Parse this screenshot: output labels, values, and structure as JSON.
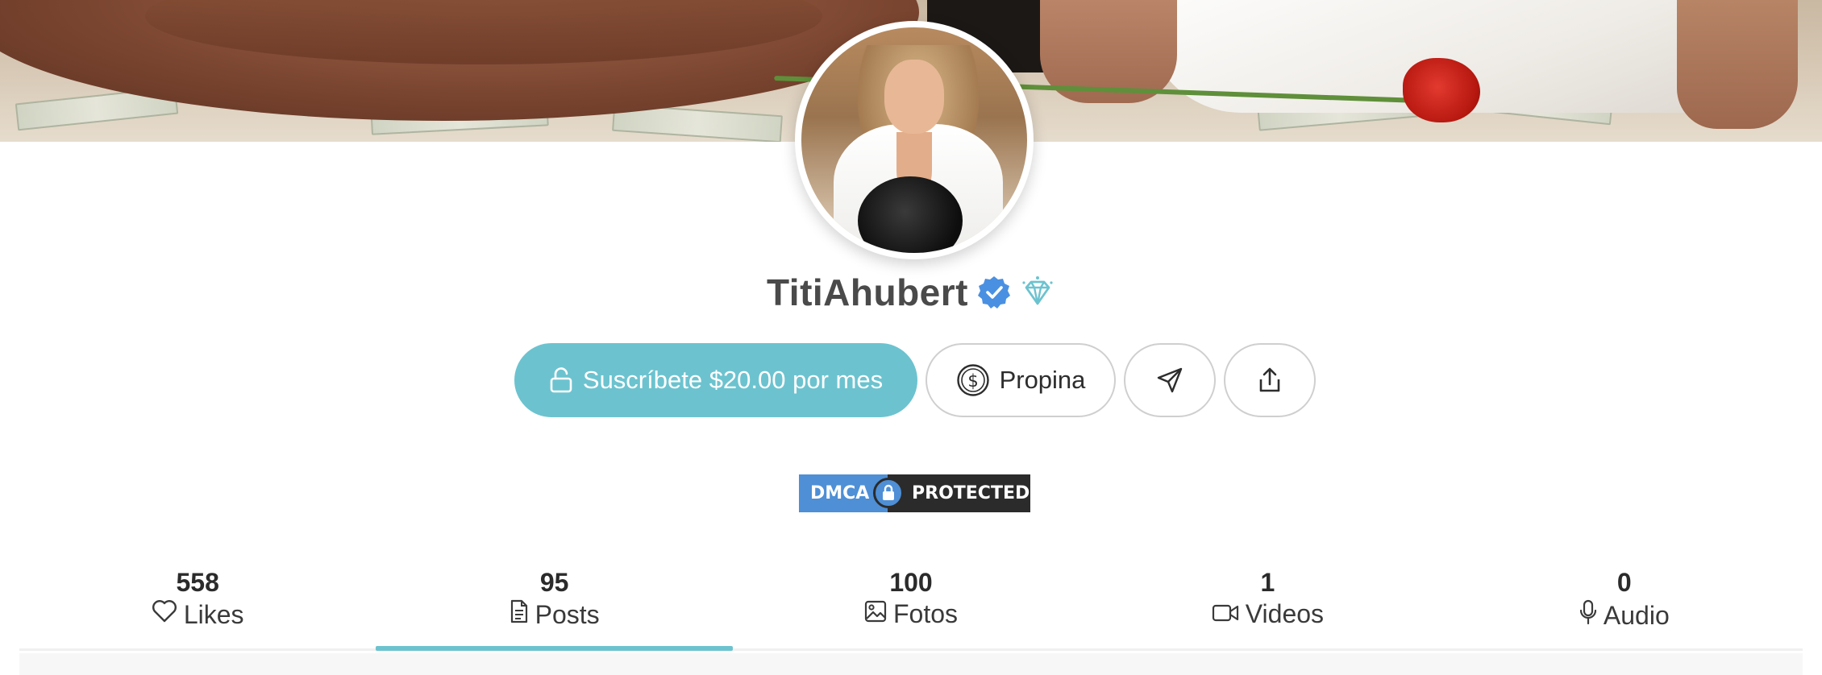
{
  "profile": {
    "username": "TitiAhubert",
    "verified_icon": "verified-check-icon",
    "tier_icon": "diamond-icon"
  },
  "actions": {
    "subscribe_label": "Suscríbete $20.00 por mes",
    "subscribe_icon": "unlock-icon",
    "tip_label": "Propina",
    "tip_icon": "dollar-coin-icon",
    "message_icon": "send-icon",
    "share_icon": "share-icon"
  },
  "dmca": {
    "left_text": "DMCA",
    "right_text": "PROTECTED"
  },
  "stats": [
    {
      "count": "558",
      "label": "Likes",
      "icon": "heart-icon"
    },
    {
      "count": "95",
      "label": "Posts",
      "icon": "document-icon",
      "active": true
    },
    {
      "count": "100",
      "label": "Fotos",
      "icon": "image-icon"
    },
    {
      "count": "1",
      "label": "Videos",
      "icon": "video-icon"
    },
    {
      "count": "0",
      "label": "Audio",
      "icon": "microphone-icon"
    }
  ],
  "colors": {
    "accent": "#6cc3cf",
    "verified_blue": "#4a90e2",
    "dmca_blue": "#4e8fd6",
    "dmca_dark": "#2b2b2b"
  }
}
